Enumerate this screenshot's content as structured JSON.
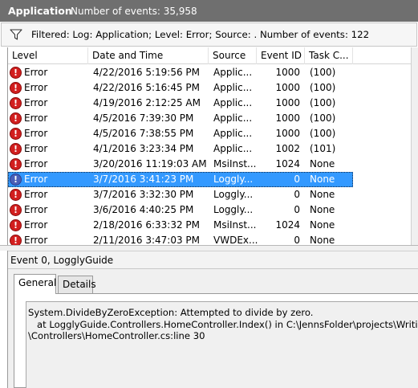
{
  "titlebar": {
    "app_name": "Application",
    "event_count": "Number of events: 35,958"
  },
  "filterbar": {
    "icon": "filter-funnel-icon",
    "text": "Filtered: Log: Application; Level: Error; Source: . Number of events: 122"
  },
  "columns": [
    "Level",
    "Date and Time",
    "Source",
    "Event ID",
    "Task C..."
  ],
  "rows": [
    {
      "level": "Error",
      "date": "4/22/2016 5:19:56 PM",
      "source": "Applic...",
      "event_id": "1000",
      "task": "(100)"
    },
    {
      "level": "Error",
      "date": "4/22/2016 5:16:45 PM",
      "source": "Applic...",
      "event_id": "1000",
      "task": "(100)"
    },
    {
      "level": "Error",
      "date": "4/19/2016 2:12:25 AM",
      "source": "Applic...",
      "event_id": "1000",
      "task": "(100)"
    },
    {
      "level": "Error",
      "date": "4/5/2016 7:39:30 PM",
      "source": "Applic...",
      "event_id": "1000",
      "task": "(100)"
    },
    {
      "level": "Error",
      "date": "4/5/2016 7:38:55 PM",
      "source": "Applic...",
      "event_id": "1000",
      "task": "(100)"
    },
    {
      "level": "Error",
      "date": "4/1/2016 3:23:34 PM",
      "source": "Applic...",
      "event_id": "1002",
      "task": "(101)"
    },
    {
      "level": "Error",
      "date": "3/20/2016 11:19:03 AM",
      "source": "MsiInst...",
      "event_id": "1024",
      "task": "None"
    },
    {
      "level": "Error",
      "date": "3/7/2016 3:41:23 PM",
      "source": "Loggly...",
      "event_id": "0",
      "task": "None",
      "selected": true
    },
    {
      "level": "Error",
      "date": "3/7/2016 3:32:30 PM",
      "source": "Loggly...",
      "event_id": "0",
      "task": "None"
    },
    {
      "level": "Error",
      "date": "3/6/2016 4:40:25 PM",
      "source": "Loggly...",
      "event_id": "0",
      "task": "None"
    },
    {
      "level": "Error",
      "date": "2/18/2016 6:33:32 PM",
      "source": "MsiInst...",
      "event_id": "1024",
      "task": "None"
    },
    {
      "level": "Error",
      "date": "2/11/2016 3:47:03 PM",
      "source": "VWDEx...",
      "event_id": "0",
      "task": "None"
    }
  ],
  "details": {
    "title": "Event 0, LogglyGuide",
    "tabs": [
      "General",
      "Details"
    ],
    "active_tab": "General",
    "message_lines": [
      "System.DivideByZeroException: Attempted to divide by zero.",
      "   at LogglyGuide.Controllers.HomeController.Index() in C:\\JennsFolder\\projects\\Writing\\Upw",
      "\\Controllers\\HomeController.cs:line 30"
    ]
  },
  "colors": {
    "titlebar_bg": "#6f6f6f",
    "selection": "#3399ff",
    "error_icon": "#d21f1f"
  }
}
